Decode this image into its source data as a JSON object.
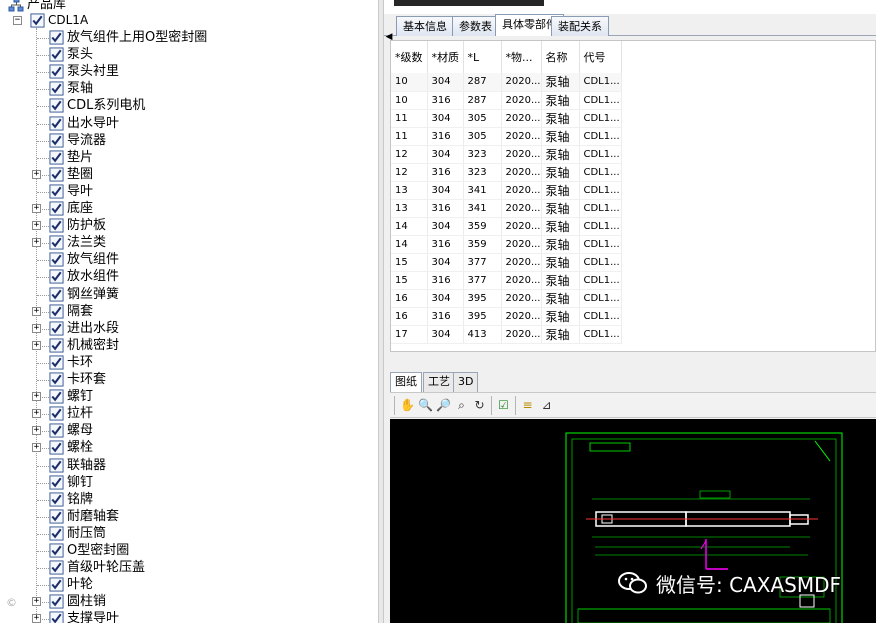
{
  "tree": {
    "root_label": "产品库",
    "node_label": "CDL1A",
    "items": [
      {
        "label": "放气组件上用O型密封圈",
        "expandable": false
      },
      {
        "label": "泵头",
        "expandable": false
      },
      {
        "label": "泵头衬里",
        "expandable": false
      },
      {
        "label": "泵轴",
        "expandable": false
      },
      {
        "label": "CDL系列电机",
        "expandable": false
      },
      {
        "label": "出水导叶",
        "expandable": false
      },
      {
        "label": "导流器",
        "expandable": false
      },
      {
        "label": "垫片",
        "expandable": false
      },
      {
        "label": "垫圈",
        "expandable": true
      },
      {
        "label": "导叶",
        "expandable": false
      },
      {
        "label": "底座",
        "expandable": true
      },
      {
        "label": "防护板",
        "expandable": true
      },
      {
        "label": "法兰类",
        "expandable": true
      },
      {
        "label": "放气组件",
        "expandable": false
      },
      {
        "label": "放水组件",
        "expandable": false
      },
      {
        "label": "钢丝弹簧",
        "expandable": false
      },
      {
        "label": "隔套",
        "expandable": true
      },
      {
        "label": "进出水段",
        "expandable": true
      },
      {
        "label": "机械密封",
        "expandable": true
      },
      {
        "label": "卡环",
        "expandable": false
      },
      {
        "label": "卡环套",
        "expandable": false
      },
      {
        "label": "螺钉",
        "expandable": true
      },
      {
        "label": "拉杆",
        "expandable": true
      },
      {
        "label": "螺母",
        "expandable": true
      },
      {
        "label": "螺栓",
        "expandable": true
      },
      {
        "label": "联轴器",
        "expandable": false
      },
      {
        "label": "铆钉",
        "expandable": false
      },
      {
        "label": "铭牌",
        "expandable": false
      },
      {
        "label": "耐磨轴套",
        "expandable": false
      },
      {
        "label": "耐压筒",
        "expandable": false
      },
      {
        "label": "O型密封圈",
        "expandable": false
      },
      {
        "label": "首级叶轮压盖",
        "expandable": false
      },
      {
        "label": "叶轮",
        "expandable": false
      },
      {
        "label": "圆柱销",
        "expandable": true
      },
      {
        "label": "支撑导叶",
        "expandable": true
      }
    ]
  },
  "tabs": {
    "items": [
      "基本信息",
      "参数表",
      "具体零部件",
      "装配关系"
    ],
    "active": 2
  },
  "table": {
    "columns": [
      "*级数",
      "*材质",
      "*L",
      "*物...",
      "名称",
      "代号"
    ],
    "rows": [
      [
        "10",
        "304",
        "287",
        "2020...",
        "泵轴",
        "CDL1..."
      ],
      [
        "10",
        "316",
        "287",
        "2020...",
        "泵轴",
        "CDL1..."
      ],
      [
        "11",
        "304",
        "305",
        "2020...",
        "泵轴",
        "CDL1..."
      ],
      [
        "11",
        "316",
        "305",
        "2020...",
        "泵轴",
        "CDL1..."
      ],
      [
        "12",
        "304",
        "323",
        "2020...",
        "泵轴",
        "CDL1..."
      ],
      [
        "12",
        "316",
        "323",
        "2020...",
        "泵轴",
        "CDL1..."
      ],
      [
        "13",
        "304",
        "341",
        "2020...",
        "泵轴",
        "CDL1..."
      ],
      [
        "13",
        "316",
        "341",
        "2020...",
        "泵轴",
        "CDL1..."
      ],
      [
        "14",
        "304",
        "359",
        "2020...",
        "泵轴",
        "CDL1..."
      ],
      [
        "14",
        "316",
        "359",
        "2020...",
        "泵轴",
        "CDL1..."
      ],
      [
        "15",
        "304",
        "377",
        "2020...",
        "泵轴",
        "CDL1..."
      ],
      [
        "15",
        "316",
        "377",
        "2020...",
        "泵轴",
        "CDL1..."
      ],
      [
        "16",
        "304",
        "395",
        "2020...",
        "泵轴",
        "CDL1..."
      ],
      [
        "16",
        "316",
        "395",
        "2020...",
        "泵轴",
        "CDL1..."
      ],
      [
        "17",
        "304",
        "413",
        "2020...",
        "泵轴",
        "CDL1..."
      ]
    ]
  },
  "viewer": {
    "tabs": [
      "图纸",
      "工艺",
      "3D"
    ],
    "active": 0,
    "toolbar_icons": [
      "pan-icon",
      "zoom-in-icon",
      "zoom-out-icon",
      "zoom-window-icon",
      "refresh-icon",
      "check-icon",
      "measure-icon",
      "annotate-icon"
    ]
  },
  "watermark": {
    "text": "微信号: CAXASMDF"
  },
  "colors": {
    "drawing_background": "#000000",
    "drawing_lines": "#00ff00",
    "drawing_axis": "#ff3333",
    "drawing_accent": "#ff00ff",
    "tab_border": "#8a9bb4"
  }
}
